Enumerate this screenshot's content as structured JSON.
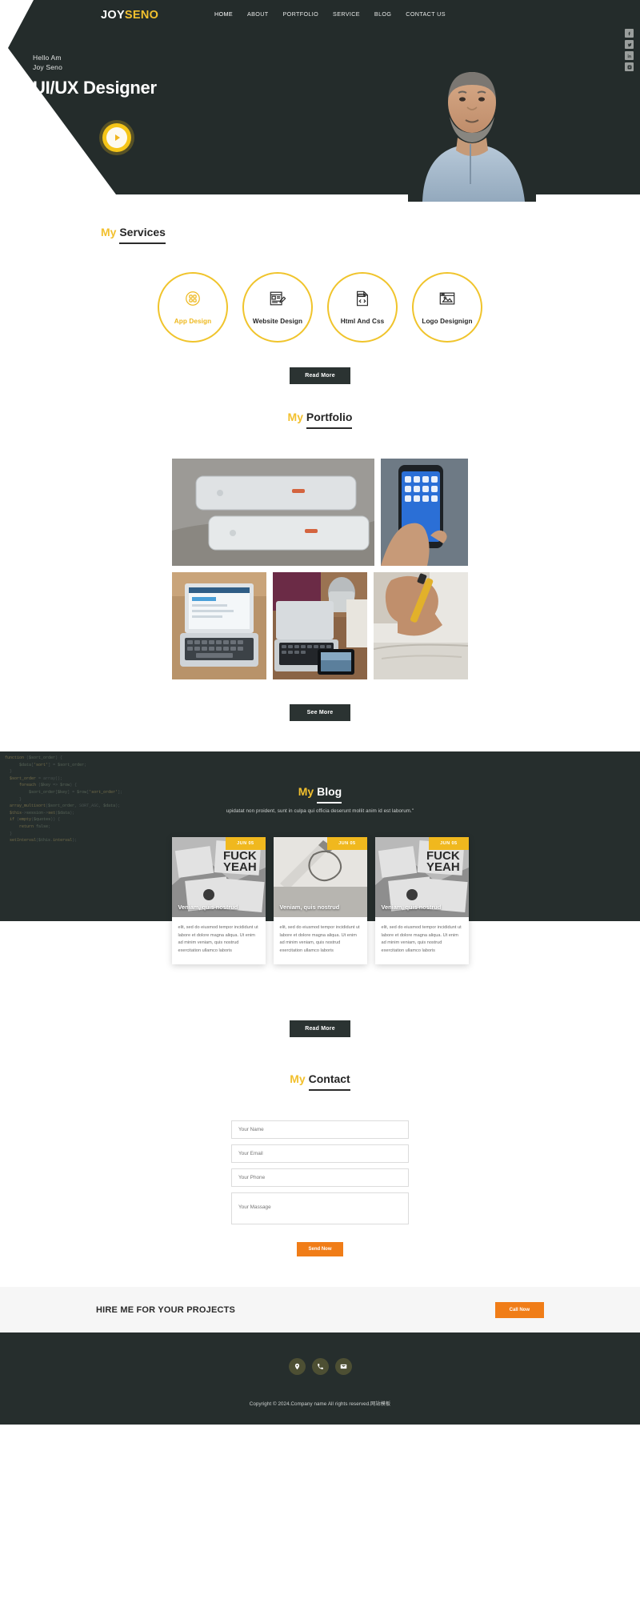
{
  "brand": {
    "first": "JOY",
    "second": "SENO"
  },
  "nav": {
    "items": [
      {
        "label": "HOME",
        "active": true
      },
      {
        "label": "ABOUT",
        "active": false
      },
      {
        "label": "PORTFOLIO",
        "active": false
      },
      {
        "label": "SERVICE",
        "active": false
      },
      {
        "label": "BLOG",
        "active": false
      },
      {
        "label": "CONTACT US",
        "active": false
      }
    ]
  },
  "social_rail": [
    {
      "name": "facebook-icon",
      "glyph": "f"
    },
    {
      "name": "twitter-icon",
      "glyph": "t"
    },
    {
      "name": "linkedin-icon",
      "glyph": "in"
    },
    {
      "name": "instagram-icon",
      "glyph": "ig"
    }
  ],
  "hero": {
    "greeting_line1": "Hello Am",
    "greeting_line2": "Joy Seno",
    "title": "UI/UX Designer",
    "play_label": "play-video"
  },
  "services": {
    "heading_my": "My",
    "heading_rest": "Services",
    "items": [
      {
        "label": "App Design",
        "icon": "app-design-icon",
        "active": true
      },
      {
        "label": "Website Design",
        "icon": "website-design-icon",
        "active": false
      },
      {
        "label": "Html And Css",
        "icon": "html-css-icon",
        "active": false
      },
      {
        "label": "Logo Designign",
        "icon": "logo-design-icon",
        "active": false
      }
    ],
    "button": "Read More"
  },
  "portfolio": {
    "heading_my": "My",
    "heading_rest": "Portfolio",
    "button": "See More",
    "items": [
      {
        "name": "portfolio-item-phone-backs"
      },
      {
        "name": "portfolio-item-hand-phone"
      },
      {
        "name": "portfolio-item-laptop-desk"
      },
      {
        "name": "portfolio-item-laptop-tablet"
      },
      {
        "name": "portfolio-item-writing-hand"
      }
    ]
  },
  "blog": {
    "heading_my": "My",
    "heading_rest": "Blog",
    "subtitle": "upidatat non proident, sunt in culpa qui officia deserunt mollit anim id est laborum.\"",
    "button": "Read More",
    "posts": [
      {
        "date": "JUN 05",
        "title": "Veniam, quis nostrud",
        "excerpt": "elit, sed do eiusmod tempor incididunt ut labore et dolore magna aliqua. Ut enim ad minim veniam, quis nostrud exercitation ullamco laboris"
      },
      {
        "date": "JUN 05",
        "title": "Veniam, quis nostrud",
        "excerpt": "elit, sed do eiusmod tempor incididunt ut labore et dolore magna aliqua. Ut enim ad minim veniam, quis nostrud exercitation ullamco laboris"
      },
      {
        "date": "JUN 05",
        "title": "Veniam, quis nostrud",
        "excerpt": "elit, sed do eiusmod tempor incididunt ut labore et dolore magna aliqua. Ut enim ad minim veniam, quis nostrud exercitation ullamco laboris"
      }
    ]
  },
  "contact": {
    "heading_my": "My",
    "heading_rest": "Contact",
    "name_placeholder": "Your Name",
    "email_placeholder": "Your Email",
    "phone_placeholder": "Your Phone",
    "message_placeholder": "Your Massage",
    "submit": "Send Now"
  },
  "hire": {
    "title": "HIRE ME FOR YOUR PROJECTS",
    "button": "Call Now"
  },
  "footer": {
    "social": [
      {
        "name": "location-icon"
      },
      {
        "name": "phone-icon"
      },
      {
        "name": "email-icon"
      }
    ],
    "copyright": "Copyright © 2024.Company name All rights reserved.网站模板"
  },
  "colors": {
    "accent_yellow": "#f2c02e",
    "dark": "#262e2d",
    "orange": "#f07d18"
  }
}
